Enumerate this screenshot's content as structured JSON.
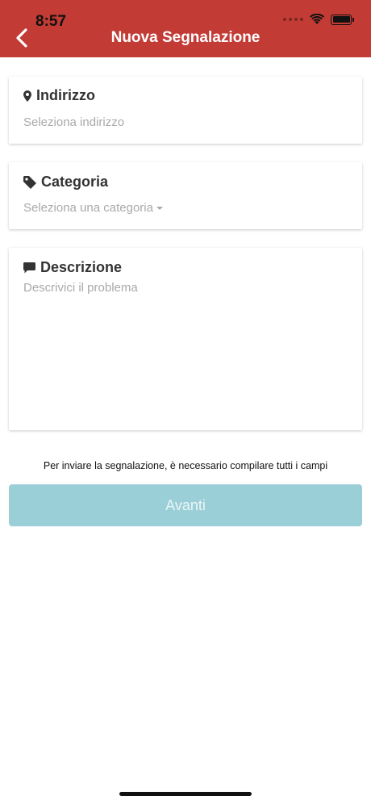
{
  "status_bar": {
    "time": "8:57"
  },
  "header": {
    "title": "Nuova Segnalazione",
    "back_icon": "chevron-left-icon"
  },
  "form": {
    "address": {
      "label": "Indirizzo",
      "placeholder": "Seleziona indirizzo",
      "icon": "map-marker-icon"
    },
    "category": {
      "label": "Categoria",
      "placeholder": "Seleziona una categoria",
      "icon": "tag-icon"
    },
    "description": {
      "label": "Descrizione",
      "placeholder": "Descrivici il problema",
      "icon": "comment-icon"
    }
  },
  "notice": "Per inviare la segnalazione, è necessario compilare tutti i campi",
  "submit_label": "Avanti",
  "colors": {
    "header": "#c23b35",
    "button": "#9bcfd8"
  }
}
